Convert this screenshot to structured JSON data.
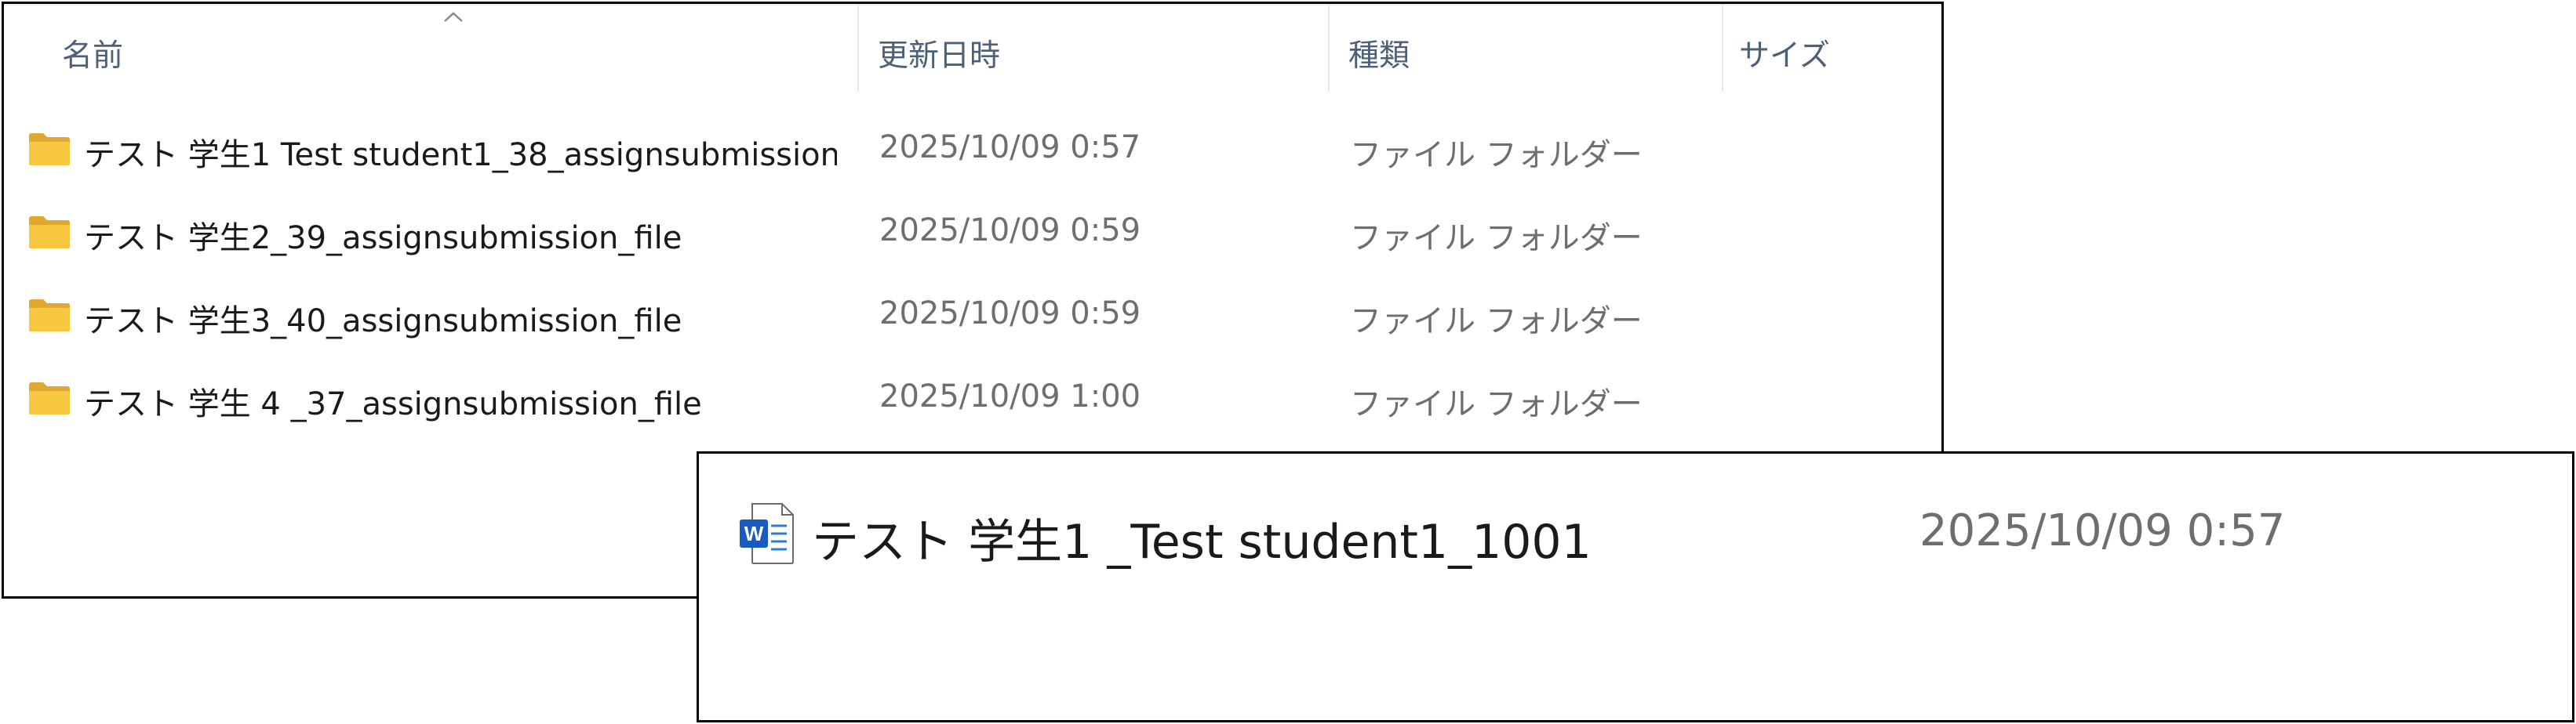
{
  "explorer": {
    "columns": {
      "name": "名前",
      "modified": "更新日時",
      "type": "種類",
      "size": "サイズ"
    },
    "rows": [
      {
        "icon": "folder-icon",
        "name": "テスト 学生1 Test student1_38_assignsubmission...",
        "modified": "2025/10/09 0:57",
        "type": "ファイル フォルダー"
      },
      {
        "icon": "folder-icon",
        "name": "テスト 学生2_39_assignsubmission_file",
        "modified": "2025/10/09 0:59",
        "type": "ファイル フォルダー"
      },
      {
        "icon": "folder-icon",
        "name": "テスト 学生3_40_assignsubmission_file",
        "modified": "2025/10/09 0:59",
        "type": "ファイル フォルダー"
      },
      {
        "icon": "folder-icon",
        "name": "テスト 学生 4 _37_assignsubmission_file",
        "modified": "2025/10/09 1:00",
        "type": "ファイル フォルダー"
      }
    ],
    "sort_indicator": "chevron-up-icon"
  },
  "detail": {
    "icon": "word-document-icon",
    "name": "テスト 学生1 _Test student1_1001",
    "modified": "2025/10/09 0:57"
  },
  "colors": {
    "folder_yellow": "#f8c742",
    "word_blue": "#185abd",
    "header_text": "#4c607a",
    "secondary_text": "#6e6e6e"
  }
}
